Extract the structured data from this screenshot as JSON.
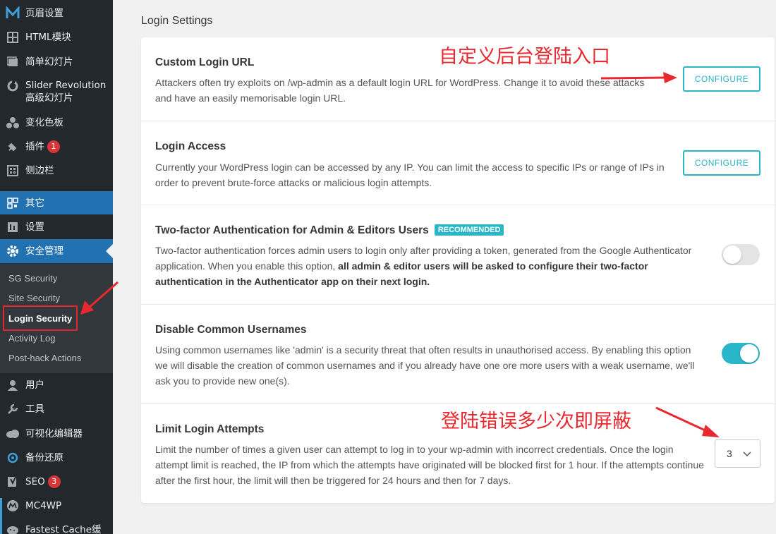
{
  "sidebar": {
    "items": [
      {
        "label": "页眉设置",
        "icon": "m-logo-icon"
      },
      {
        "label": "HTML模块",
        "icon": "grid-icon"
      },
      {
        "label": "简单幻灯片",
        "icon": "slides-icon"
      },
      {
        "label": "Slider Revolution",
        "label2": "高级幻灯片",
        "icon": "refresh-icon"
      },
      {
        "label": "变化色板",
        "icon": "palette-icon"
      },
      {
        "label": "插件",
        "icon": "plugin-icon",
        "badge": "1"
      },
      {
        "label": "侧边栏",
        "icon": "sidebar-icon"
      },
      {
        "label": "其它",
        "icon": "qr-icon"
      },
      {
        "label": "设置",
        "icon": "settings-icon"
      },
      {
        "label": "安全管理",
        "icon": "gear-icon"
      },
      {
        "label": "用户",
        "icon": "user-icon"
      },
      {
        "label": "工具",
        "icon": "wrench-icon"
      },
      {
        "label": "可视化编辑器",
        "icon": "cloud-icon"
      },
      {
        "label": "备份还原",
        "icon": "backup-icon"
      },
      {
        "label": "SEO",
        "icon": "yoast-icon",
        "badge": "3"
      },
      {
        "label": "MC4WP",
        "icon": "mc4wp-icon"
      },
      {
        "label": "Fastest Cache缓",
        "icon": "cheetah-icon"
      }
    ],
    "submenu": [
      "SG Security",
      "Site Security",
      "Login Security",
      "Activity Log",
      "Post-hack Actions"
    ]
  },
  "main": {
    "heading": "Login Settings",
    "sections": {
      "custom_login": {
        "title": "Custom Login URL",
        "desc": "Attackers often try exploits on /wp-admin as a default login URL for WordPress. Change it to avoid these attacks and have an easily memorisable login URL.",
        "button": "CONFIGURE"
      },
      "login_access": {
        "title": "Login Access",
        "desc": "Currently your WordPress login can be accessed by any IP. You can limit the access to specific IPs or range of IPs in order to prevent brute-force attacks or malicious login attempts.",
        "button": "CONFIGURE"
      },
      "two_factor": {
        "title": "Two-factor Authentication for Admin & Editors Users",
        "badge": "RECOMMENDED",
        "desc_plain": "Two-factor authentication forces admin users to login only after providing a token, generated from the Google Authenticator application. When you enable this option, ",
        "desc_bold": "all admin & editor users will be asked to configure their two-factor authentication in the Authenticator app on their next login.",
        "enabled": false
      },
      "common_usernames": {
        "title": "Disable Common Usernames",
        "desc": "Using common usernames like 'admin' is a security threat that often results in unauthorised access. By enabling this option we will disable the creation of common usernames and if you already have one ore more users with a weak username, we'll ask you to provide new one(s).",
        "enabled": true
      },
      "limit_attempts": {
        "title": "Limit Login Attempts",
        "desc": "Limit the number of times a given user can attempt to log in to your wp-admin with incorrect credentials. Once the login attempt limit is reached, the IP from which the attempts have originated will be blocked first for 1 hour. If the attempts continue after the first hour, the limit will then be triggered for 24 hours and then for 7 days.",
        "value": "3"
      }
    }
  },
  "annotations": {
    "top": "自定义后台登陆入口",
    "bottom": "登陆错误多少次即屏蔽"
  },
  "colors": {
    "accent": "#29b6c8",
    "sidebar": "#23282d",
    "wp_blue": "#2271b1",
    "annotation_red": "#e8282e"
  }
}
